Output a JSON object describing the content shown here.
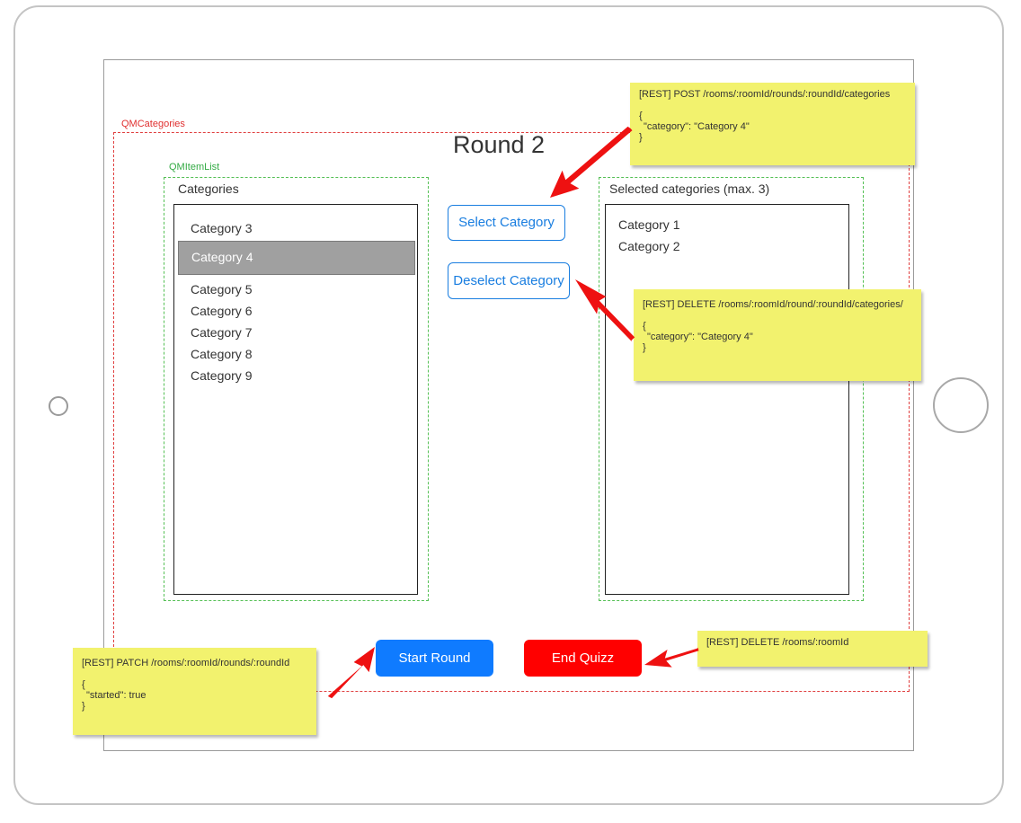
{
  "qm_categories": {
    "label": "QMCategories",
    "round_title": "Round 2",
    "item_list_label": "QMItemList",
    "available": {
      "heading": "Categories",
      "items": [
        {
          "label": "Category 3"
        },
        {
          "label": "Category 4"
        },
        {
          "label": "Category 5"
        },
        {
          "label": "Category 6"
        },
        {
          "label": "Category 7"
        },
        {
          "label": "Category 8"
        },
        {
          "label": "Category 9"
        }
      ],
      "highlighted": "Category 4"
    },
    "selected": {
      "heading": "Selected categories (max. 3)",
      "items": [
        {
          "label": "Category 1"
        },
        {
          "label": "Category 2"
        }
      ]
    },
    "buttons": {
      "select_label": "Select Category",
      "deselect_label": "Deselect Category",
      "start_label": "Start Round",
      "end_label": "End Quizz"
    }
  },
  "notes": {
    "post": {
      "request": "[REST] POST /rooms/:roomId/rounds/:roundId/categories",
      "open": "{",
      "body": "\"category\": \"Category 4\"",
      "close": "}"
    },
    "delete_category": {
      "request": "[REST] DELETE /rooms/:roomId/round/:roundId/categories/",
      "open": "{",
      "body": "\"category\": \"Category 4\"",
      "close": "}"
    },
    "patch": {
      "request": "[REST] PATCH /rooms/:roomId/rounds/:roundId",
      "open": "{",
      "body": "\"started\": true",
      "close": "}"
    },
    "delete_room": {
      "request": "[REST] DELETE /rooms/:roomId"
    }
  },
  "colors": {
    "accent_blue": "#1a7ee0",
    "start_button": "#0f7bff",
    "end_button": "#ff0000",
    "note_yellow": "#f2f26e",
    "frame_red": "#e04040",
    "frame_green": "#55c055",
    "arrow_red": "#ee1111",
    "highlight_gray": "#a0a0a0"
  }
}
